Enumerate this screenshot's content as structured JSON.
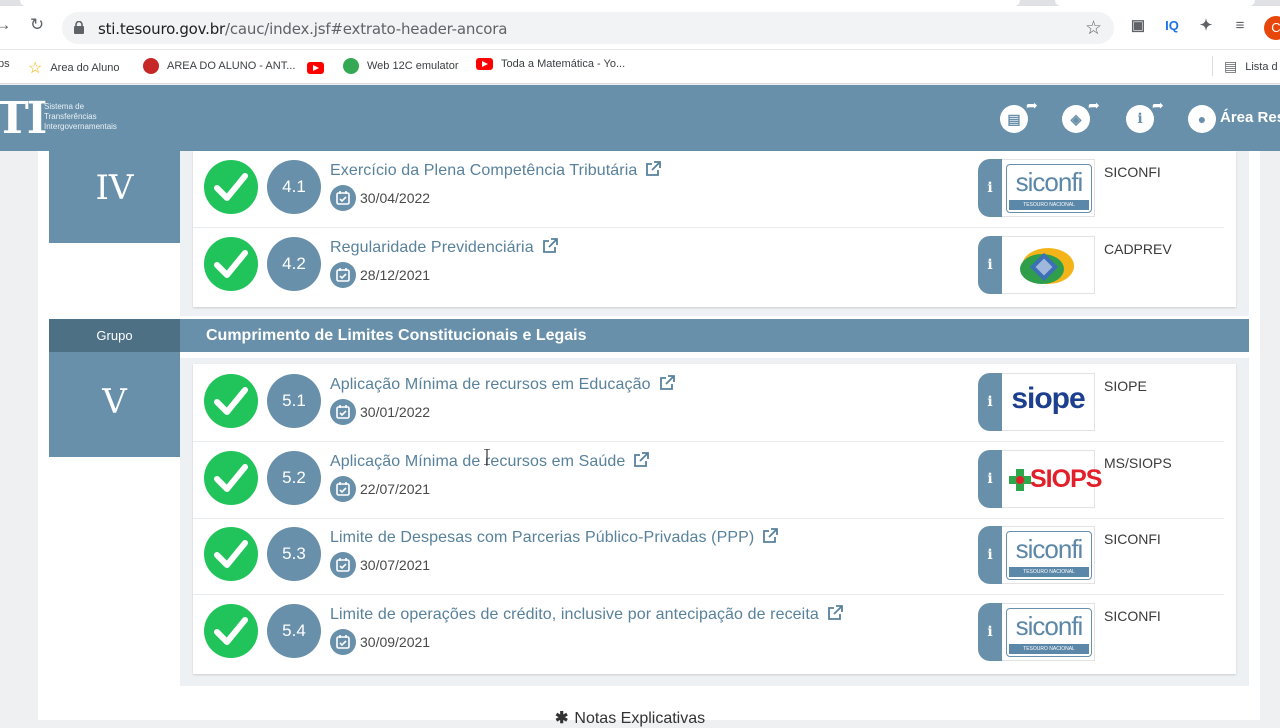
{
  "browser": {
    "url_host": "sti.tesouro.gov.br",
    "url_path": "/cauc/index.jsf#extrato-header-ancora",
    "profile_initial": "C",
    "bookmarks": [
      {
        "label": "ps",
        "icon": "apps-icon"
      },
      {
        "label": "Area do Aluno",
        "icon": "star-icon"
      },
      {
        "label": "AREA DO ALUNO - ANT...",
        "icon": "hat-icon"
      },
      {
        "label": "",
        "icon": "youtube-icon"
      },
      {
        "label": "Web 12C emulator",
        "icon": "extension-icon"
      },
      {
        "label": "Toda a Matemática - Yo...",
        "icon": "youtube-icon"
      },
      {
        "label": "Lista d",
        "icon": "reading-list-icon"
      }
    ]
  },
  "header": {
    "logo": "TI",
    "logo_text_lines": [
      "Sistema de",
      "Transferências",
      "Intergovernamentais"
    ],
    "area_label": "Área Rest"
  },
  "groups": [
    {
      "roman": "IV",
      "items": [
        {
          "num": "4.1",
          "title": "Exercício da Plena Competência Tributária",
          "date": "30/04/2022",
          "system": "SICONFI",
          "logo": "siconfi"
        },
        {
          "num": "4.2",
          "title": "Regularidade Previdenciária",
          "date": "28/12/2021",
          "system": "CADPREV",
          "logo": "cadprev"
        }
      ]
    },
    {
      "label": "Grupo",
      "roman": "V",
      "title": "Cumprimento de Limites Constitucionais e Legais",
      "items": [
        {
          "num": "5.1",
          "title": "Aplicação Mínima de recursos em Educação",
          "date": "30/01/2022",
          "system": "SIOPE",
          "logo": "siope"
        },
        {
          "num": "5.2",
          "title": "Aplicação Mínima de recursos em Saúde",
          "date": "22/07/2021",
          "system": "MS/SIOPS",
          "logo": "siops"
        },
        {
          "num": "5.3",
          "title": "Limite de Despesas com Parcerias Público-Privadas (PPP)",
          "date": "30/07/2021",
          "system": "SICONFI",
          "logo": "siconfi"
        },
        {
          "num": "5.4",
          "title": "Limite de operações de crédito, inclusive por antecipação de receita",
          "date": "30/09/2021",
          "system": "SICONFI",
          "logo": "siconfi"
        }
      ]
    }
  ],
  "logos": {
    "siconfi_word": "siconfi",
    "siconfi_band": "TESOURO NACIONAL",
    "siope_word": "siope",
    "siops_word": "SIOPS"
  },
  "footer": {
    "notas": "Notas Explicativas"
  },
  "info_glyph": "i",
  "colors": {
    "brand": "#6890aa",
    "ok": "#21c45a",
    "link": "#58819c"
  }
}
